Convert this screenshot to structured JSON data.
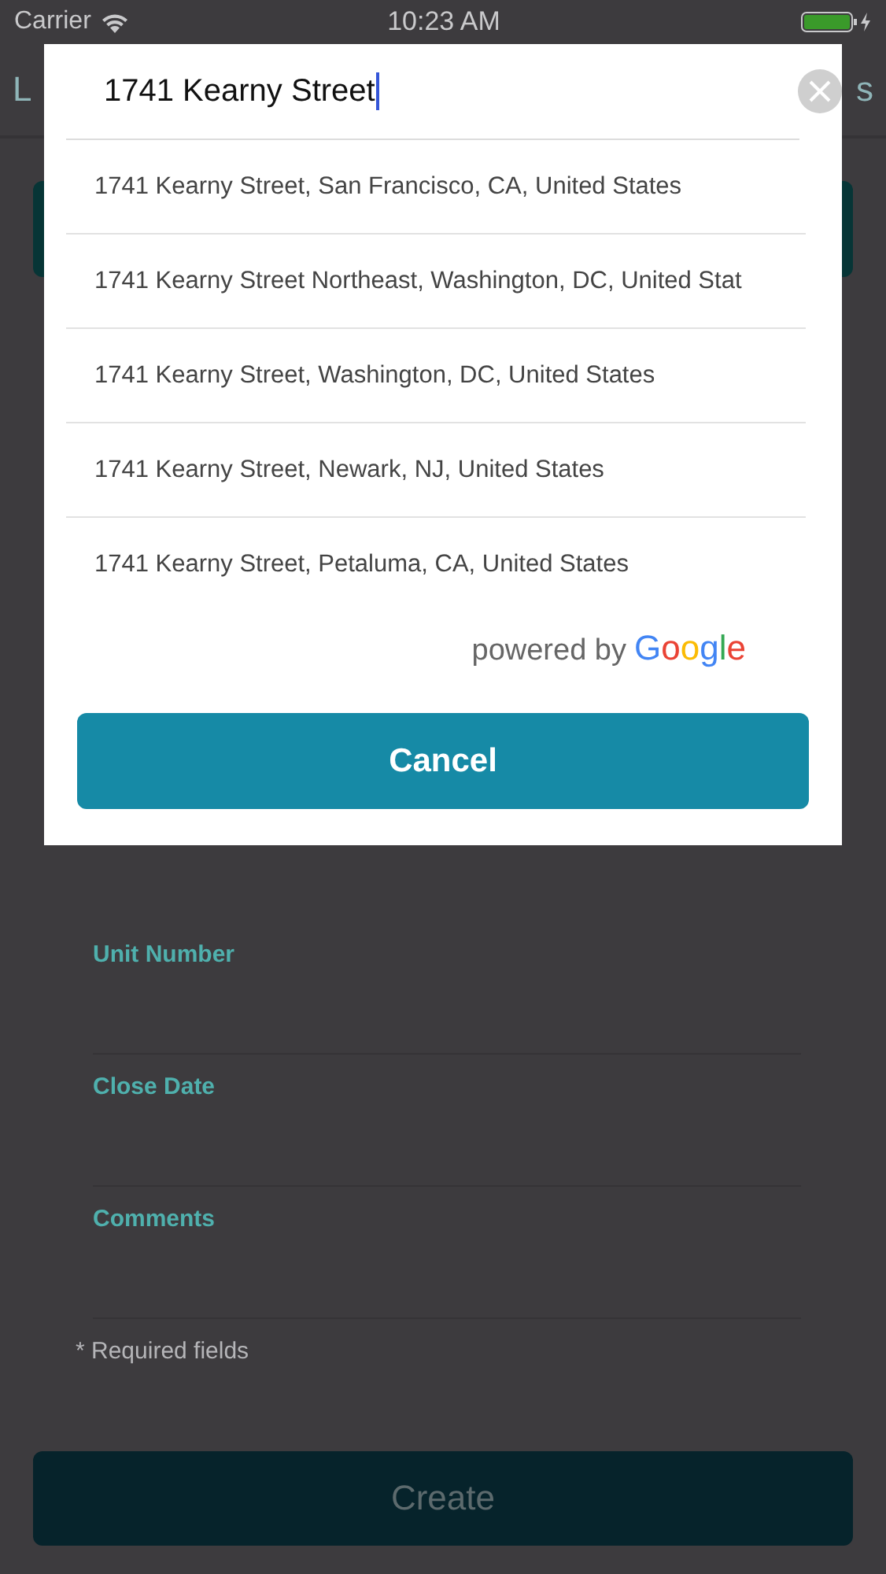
{
  "status_bar": {
    "carrier": "Carrier",
    "time": "10:23 AM"
  },
  "background": {
    "nav_left": "L",
    "nav_right": "s",
    "fields": [
      {
        "label": "Unit Number"
      },
      {
        "label": "Close Date"
      },
      {
        "label": "Comments"
      }
    ],
    "note": "* Required fields",
    "create_button": "Create"
  },
  "modal": {
    "search": {
      "value": "1741 Kearny Street"
    },
    "results": [
      "1741 Kearny Street, San Francisco, CA, United States",
      "1741 Kearny Street Northeast, Washington, DC, United Stat",
      "1741 Kearny Street, Washington, DC, United States",
      "1741 Kearny Street, Newark, NJ, United States",
      "1741 Kearny Street, Petaluma, CA, United States"
    ],
    "attribution": {
      "prefix": "powered by",
      "brand": "Google"
    },
    "cancel_button": "Cancel"
  }
}
